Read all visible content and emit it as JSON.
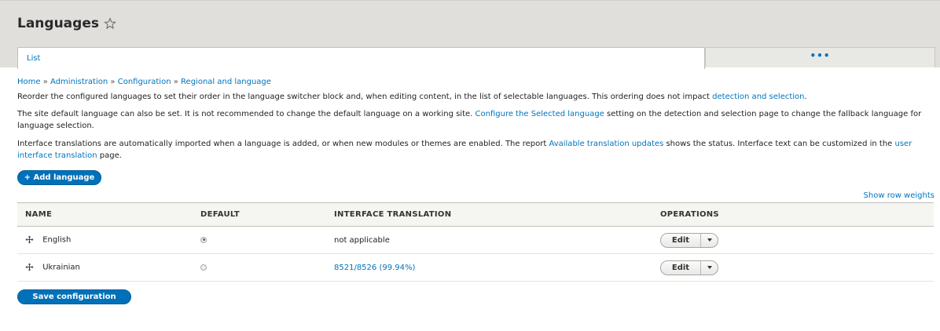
{
  "header": {
    "title": "Languages",
    "tabs": [
      {
        "label": "List"
      },
      {
        "label": "•••"
      }
    ]
  },
  "breadcrumb": [
    {
      "label": "Home"
    },
    {
      "label": "Administration"
    },
    {
      "label": "Configuration"
    },
    {
      "label": "Regional and language"
    }
  ],
  "breadcrumb_sep": "»",
  "intro": {
    "p1_text": "Reorder the configured languages to set their order in the language switcher block and, when editing content, in the list of selectable languages. This ordering does not impact ",
    "p1_link": "detection and selection",
    "p1_end": ".",
    "p2_text": "The site default language can also be set. It is not recommended to change the default language on a working site. ",
    "p2_link": "Configure the Selected language",
    "p2_end": " setting on the detection and selection page to change the fallback language for language selection.",
    "p3_text": "Interface translations are automatically imported when a language is added, or when new modules or themes are enabled. The report ",
    "p3_link": "Available translation updates",
    "p3_mid": " shows the status. Interface text can be customized in the ",
    "p3_link2": "user interface translation",
    "p3_end": " page."
  },
  "add_language_label": "+ Add language",
  "show_row_weights_label": "Show row weights",
  "table": {
    "columns": [
      "NAME",
      "DEFAULT",
      "INTERFACE TRANSLATION",
      "OPERATIONS"
    ],
    "rows": [
      {
        "name": "English",
        "default": true,
        "translation": "not applicable",
        "translation_is_link": false,
        "operation": "Edit"
      },
      {
        "name": "Ukrainian",
        "default": false,
        "translation": "8521/8526 (99.94%)",
        "translation_is_link": true,
        "operation": "Edit"
      }
    ]
  },
  "save_label": "Save configuration",
  "colors": {
    "link": "#0074bd",
    "primary_button": "#0071b8",
    "header_bg": "#e0dfdc"
  }
}
